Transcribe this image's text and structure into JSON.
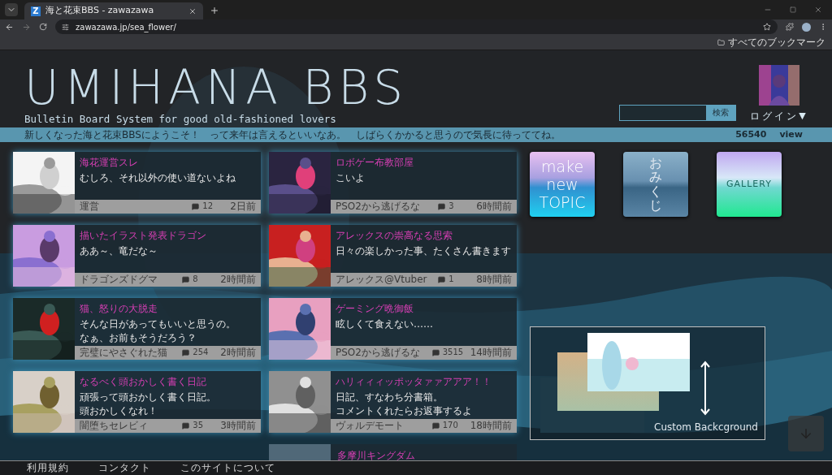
{
  "browser": {
    "tab_title": "海と花束BBS - zawazawa",
    "favicon": "Z",
    "url": "zawazawa.jp/sea_flower/",
    "bookmarks_label": "すべてのブックマーク"
  },
  "header": {
    "title": "UMIHANA BBS",
    "subtitle": "Bulletin Board System for good old-fashioned lovers",
    "search_button": "検索",
    "login": "ログイン",
    "login_caret": "▼"
  },
  "announcement": {
    "text": "新しくなった海と花束BBSにようこそ！　って来年は言えるといいなあ。　しばらくかかると思うので気長に待っててね。",
    "views": "56540",
    "views_label": "view"
  },
  "topics": [
    {
      "title": "海花運営スレ",
      "message": [
        "むしろ、それ以外の使い道ないよね"
      ],
      "author": "運営",
      "comments": "12",
      "time": "2日前"
    },
    {
      "title": "ロボゲー布教部屋",
      "message": [
        "こいよ"
      ],
      "author": "PSO2から逃げるな",
      "comments": "3",
      "time": "6時間前"
    },
    {
      "title": "描いたイラスト発表ドラゴン",
      "message": [
        "ああ～、竜だな～"
      ],
      "author": "ドラゴンズドグマ",
      "comments": "8",
      "time": "2時間前"
    },
    {
      "title": "アレックスの崇高なる思索",
      "message": [
        "日々の楽しかった事、たくさん書きます"
      ],
      "author": "アレックス@Vtuber",
      "comments": "1",
      "time": "8時間前"
    },
    {
      "title": "猫、怒りの大脱走",
      "message": [
        "そんな日があってもいいと思うの。",
        "なぁ、お前もそうだろう？"
      ],
      "author": "完璧にやさぐれた猫",
      "comments": "254",
      "time": "2時間前"
    },
    {
      "title": "ゲーミング晩御飯",
      "message": [
        "眩しくて食えない……"
      ],
      "author": "PSO2から逃げるな",
      "comments": "3515",
      "time": "14時間前"
    },
    {
      "title": "なるべく頭おかしく書く日記",
      "message": [
        "頑張って頭おかしく書く日記。",
        "頭おかしくなれ！"
      ],
      "author": "闇堕ちセレビィ",
      "comments": "35",
      "time": "3時間前"
    },
    {
      "title": "ハリィィィッポッタァァアアア！！",
      "message": [
        "日記、すなわち分書箱。",
        "コメントくれたらお返事するよ"
      ],
      "author": "ヴォルデモート",
      "comments": "170",
      "time": "18時間前"
    }
  ],
  "partial_topic": {
    "title": "多摩川キングダム"
  },
  "tiles": [
    {
      "kind": "lines",
      "lines": [
        "make",
        "new",
        "TOPIC"
      ]
    },
    {
      "kind": "vertical",
      "lines": [
        "おみくじ"
      ]
    },
    {
      "kind": "word",
      "lines": [
        "GALLERY"
      ]
    }
  ],
  "custom_background": {
    "label": "Custom Backcground"
  },
  "footer": [
    "利用規約",
    "コンタクト",
    "このサイトについて"
  ]
}
